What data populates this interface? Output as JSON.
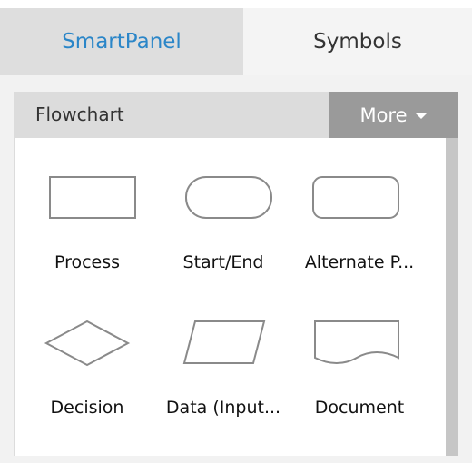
{
  "tabs": {
    "smartpanel": "SmartPanel",
    "symbols": "Symbols"
  },
  "group": {
    "title": "Flowchart",
    "more_label": "More"
  },
  "shapes": [
    {
      "label": "Process",
      "icon": "process-rectangle-icon"
    },
    {
      "label": "Start/End",
      "icon": "terminator-pill-icon"
    },
    {
      "label": "Alternate P...",
      "icon": "rounded-rectangle-icon"
    },
    {
      "label": "Decision",
      "icon": "diamond-icon"
    },
    {
      "label": "Data (Input...",
      "icon": "parallelogram-icon"
    },
    {
      "label": "Document",
      "icon": "document-wave-icon"
    }
  ],
  "colors": {
    "accent": "#2b86c8",
    "more_button": "#9a9a9a",
    "shape_stroke": "#8a8a8a"
  }
}
